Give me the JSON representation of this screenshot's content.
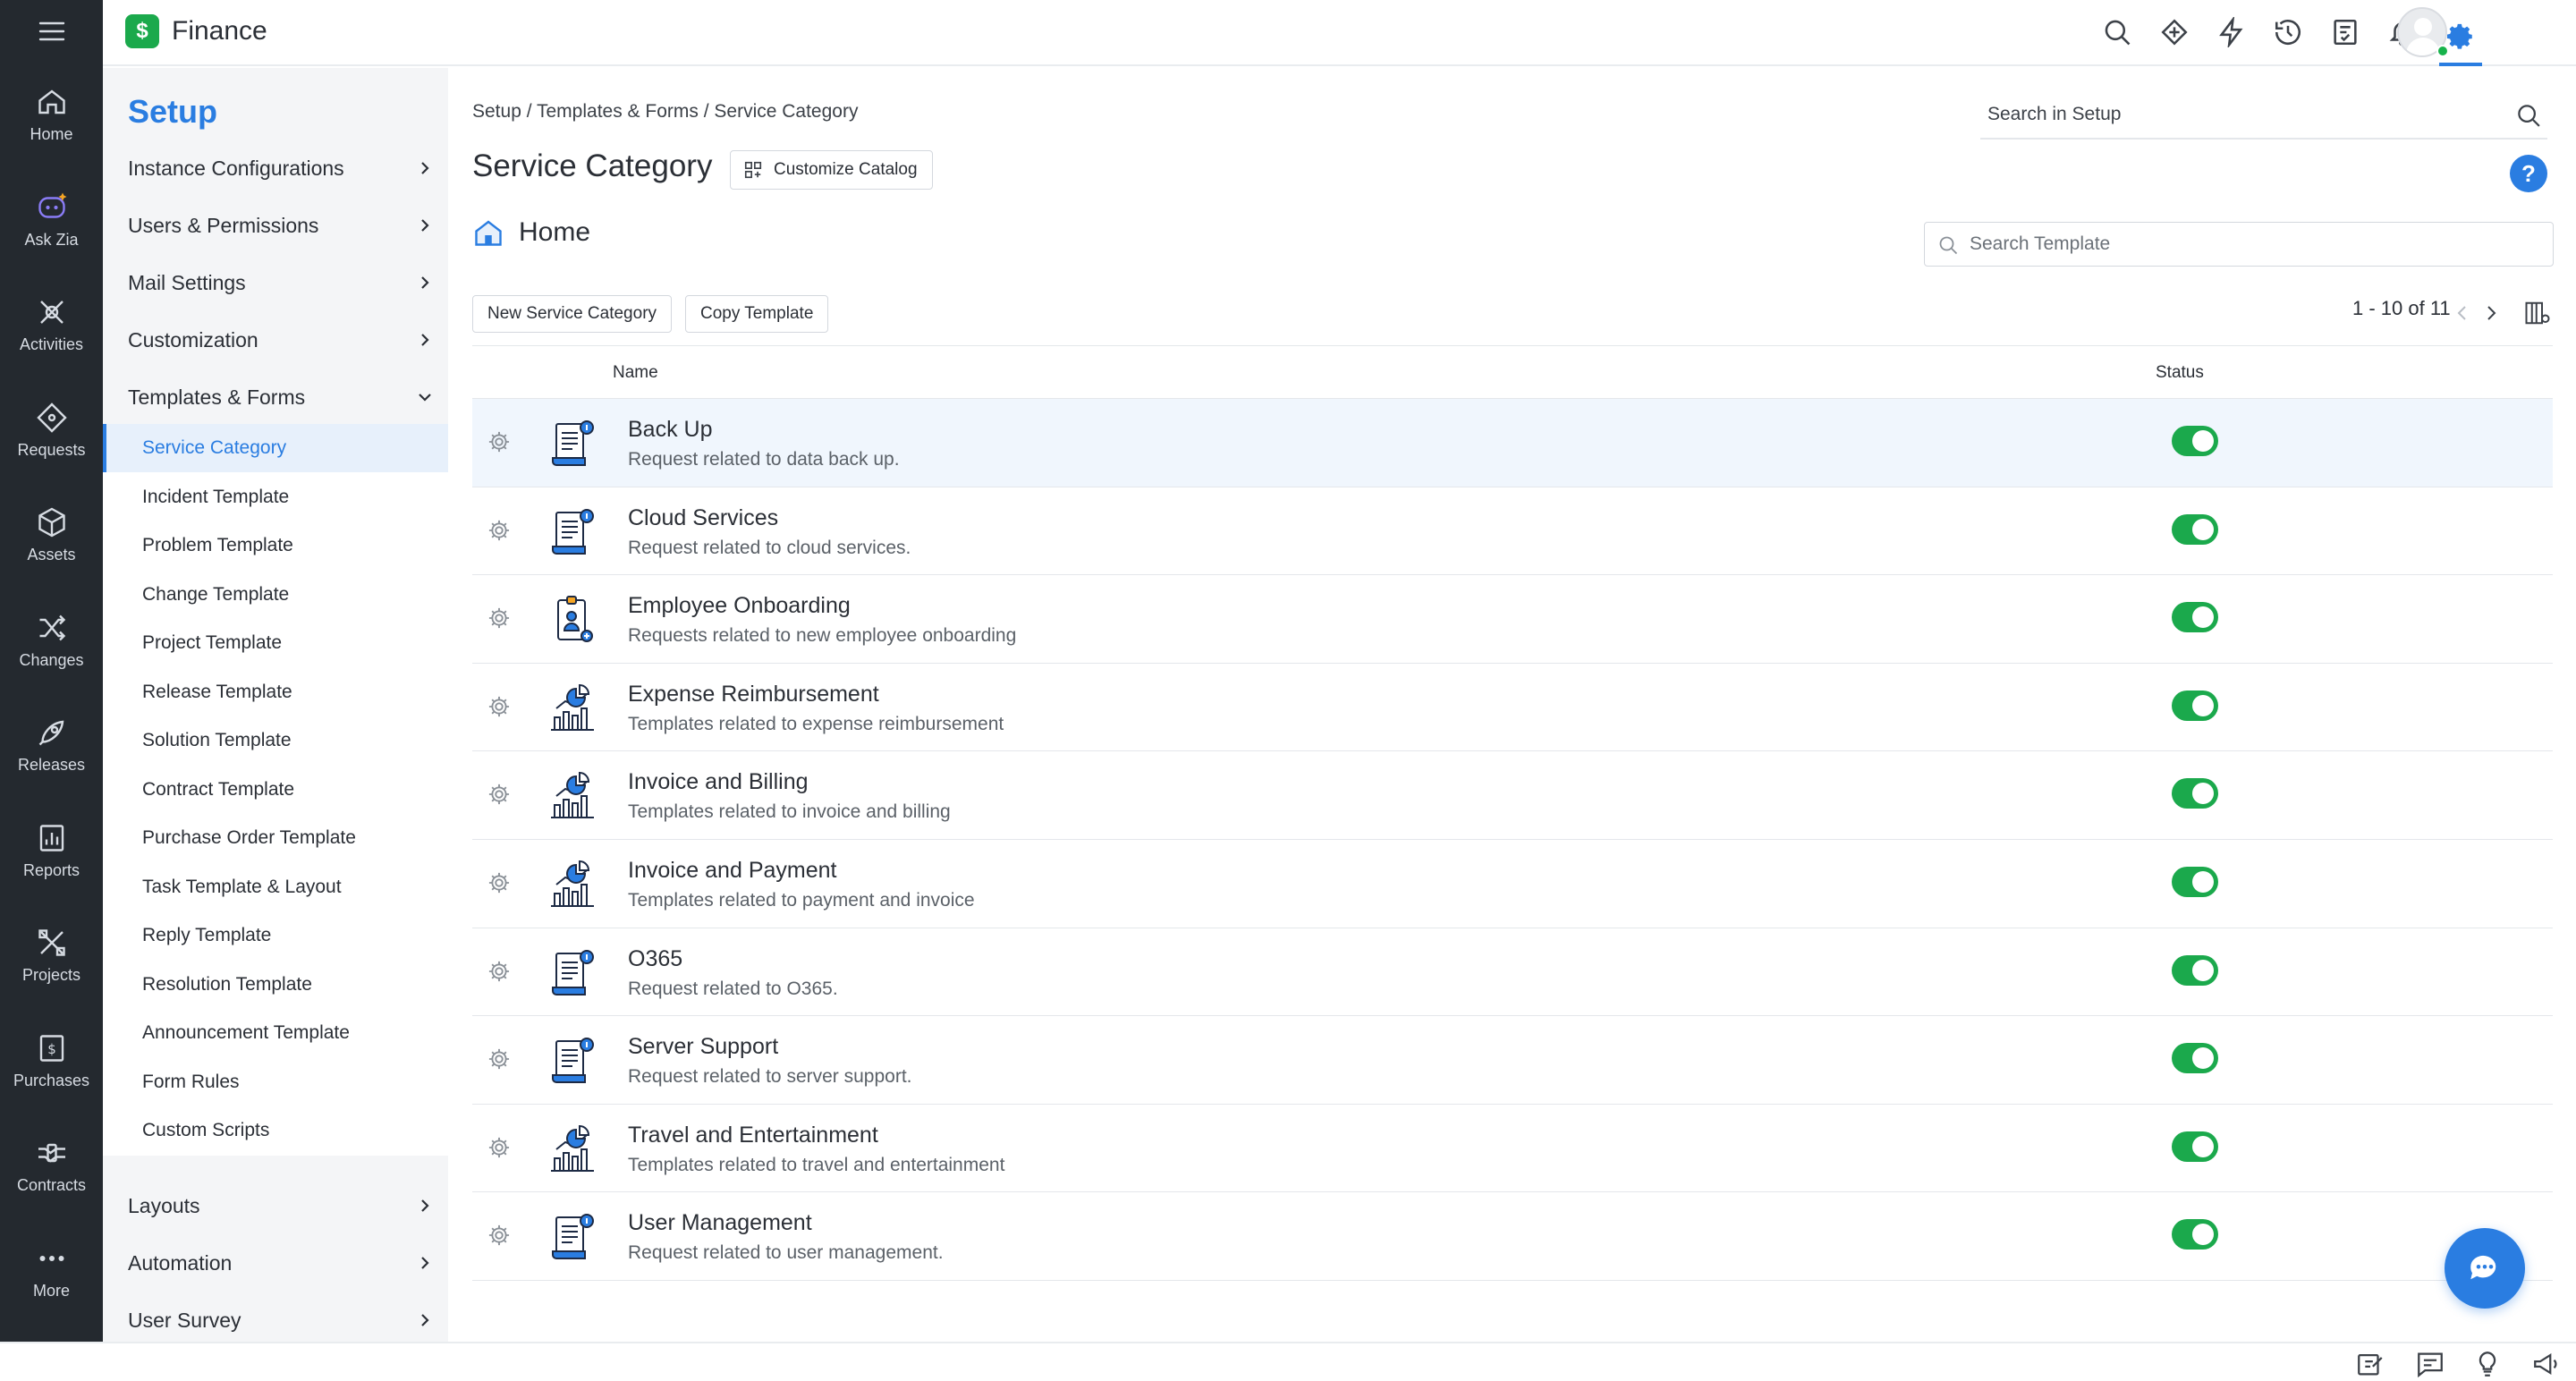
{
  "app": {
    "name": "Finance",
    "logo_letter": "$"
  },
  "rail": {
    "items": [
      {
        "label": "Home",
        "icon": "home-icon"
      },
      {
        "label": "Ask Zia",
        "icon": "ask-zia-icon"
      },
      {
        "label": "Activities",
        "icon": "activities-icon"
      },
      {
        "label": "Requests",
        "icon": "requests-icon"
      },
      {
        "label": "Assets",
        "icon": "assets-icon"
      },
      {
        "label": "Changes",
        "icon": "changes-icon"
      },
      {
        "label": "Releases",
        "icon": "releases-icon"
      },
      {
        "label": "Reports",
        "icon": "reports-icon"
      },
      {
        "label": "Projects",
        "icon": "projects-icon"
      },
      {
        "label": "Purchases",
        "icon": "purchases-icon"
      },
      {
        "label": "Contracts",
        "icon": "contracts-icon"
      },
      {
        "label": "More",
        "icon": "more-icon"
      }
    ]
  },
  "setup": {
    "title": "Setup",
    "menu": [
      {
        "label": "Instance Configurations"
      },
      {
        "label": "Users & Permissions"
      },
      {
        "label": "Mail Settings"
      },
      {
        "label": "Customization"
      },
      {
        "label": "Templates & Forms",
        "expanded": true
      }
    ],
    "submenu": [
      {
        "label": "Service Category",
        "active": true
      },
      {
        "label": "Incident Template"
      },
      {
        "label": "Problem Template"
      },
      {
        "label": "Change Template"
      },
      {
        "label": "Project Template"
      },
      {
        "label": "Release Template"
      },
      {
        "label": "Solution Template"
      },
      {
        "label": "Contract Template"
      },
      {
        "label": "Purchase Order Template"
      },
      {
        "label": "Task Template & Layout"
      },
      {
        "label": "Reply Template"
      },
      {
        "label": "Resolution Template"
      },
      {
        "label": "Announcement Template"
      },
      {
        "label": "Form Rules"
      },
      {
        "label": "Custom Scripts"
      }
    ],
    "menu_bottom": [
      {
        "label": "Layouts"
      },
      {
        "label": "Automation"
      },
      {
        "label": "User Survey"
      }
    ]
  },
  "main": {
    "breadcrumb": "Setup / Templates & Forms / Service Category",
    "title": "Service Category",
    "customize_label": "Customize Catalog",
    "search_setup_placeholder": "Search in Setup",
    "help_label": "?",
    "home_label": "Home",
    "search_template_placeholder": "Search Template",
    "new_button": "New Service Category",
    "copy_button": "Copy Template",
    "pager": "1 - 10 of 11",
    "columns": {
      "name": "Name",
      "status": "Status"
    },
    "rows": [
      {
        "name": "Back Up",
        "desc": "Request related to data back up.",
        "icon": "scroll-document-icon",
        "enabled": true
      },
      {
        "name": "Cloud Services",
        "desc": "Request related to cloud services.",
        "icon": "scroll-document-icon",
        "enabled": true
      },
      {
        "name": "Employee Onboarding",
        "desc": "Requests related to new employee onboarding",
        "icon": "id-badge-icon",
        "enabled": true
      },
      {
        "name": "Expense Reimbursement",
        "desc": "Templates related to expense reimbursement",
        "icon": "chart-report-icon",
        "enabled": true
      },
      {
        "name": "Invoice and Billing",
        "desc": "Templates related to invoice and billing",
        "icon": "chart-report-icon",
        "enabled": true
      },
      {
        "name": "Invoice and Payment",
        "desc": "Templates related to payment and invoice",
        "icon": "chart-report-icon",
        "enabled": true
      },
      {
        "name": "O365",
        "desc": "Request related to O365.",
        "icon": "scroll-document-icon",
        "enabled": true
      },
      {
        "name": "Server Support",
        "desc": "Request related to server support.",
        "icon": "scroll-document-icon",
        "enabled": true
      },
      {
        "name": "Travel and Entertainment",
        "desc": "Templates related to travel and entertainment",
        "icon": "chart-report-icon",
        "enabled": true
      },
      {
        "name": "User Management",
        "desc": "Request related to user management.",
        "icon": "scroll-document-icon",
        "enabled": true
      }
    ]
  },
  "colors": {
    "accent": "#2a7de1",
    "rail_bg": "#24292f",
    "toggle_on": "#1ba94c",
    "sidebar_bg": "#f4f5f7"
  }
}
